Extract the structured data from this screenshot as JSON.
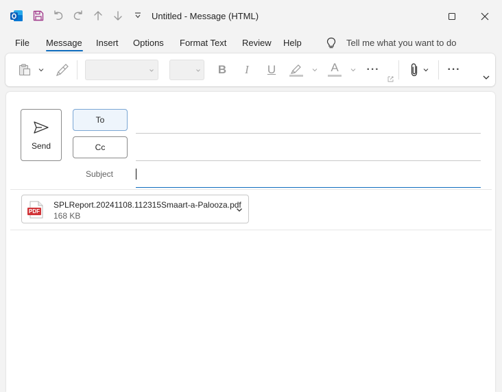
{
  "window": {
    "title": "Untitled  -  Message (HTML)",
    "app_icon": "outlook-icon",
    "accent": "#0f6cbd"
  },
  "menu": {
    "items": [
      "File",
      "Message",
      "Insert",
      "Options",
      "Format Text",
      "Review",
      "Help"
    ],
    "active": "Message",
    "search_placeholder": "Tell me what you want to do"
  },
  "ribbon": {
    "bold": "B",
    "italic": "I",
    "underline": "U",
    "font_color": "A",
    "more": "···"
  },
  "compose": {
    "send_label": "Send",
    "to_label": "To",
    "cc_label": "Cc",
    "subject_label": "Subject",
    "to_value": "",
    "cc_value": "",
    "subject_value": ""
  },
  "attachment": {
    "file_name": "SPLReport.20241108.112315Smaart-a-Palooza.pdf",
    "file_size": "168 KB",
    "file_type": "PDF"
  }
}
